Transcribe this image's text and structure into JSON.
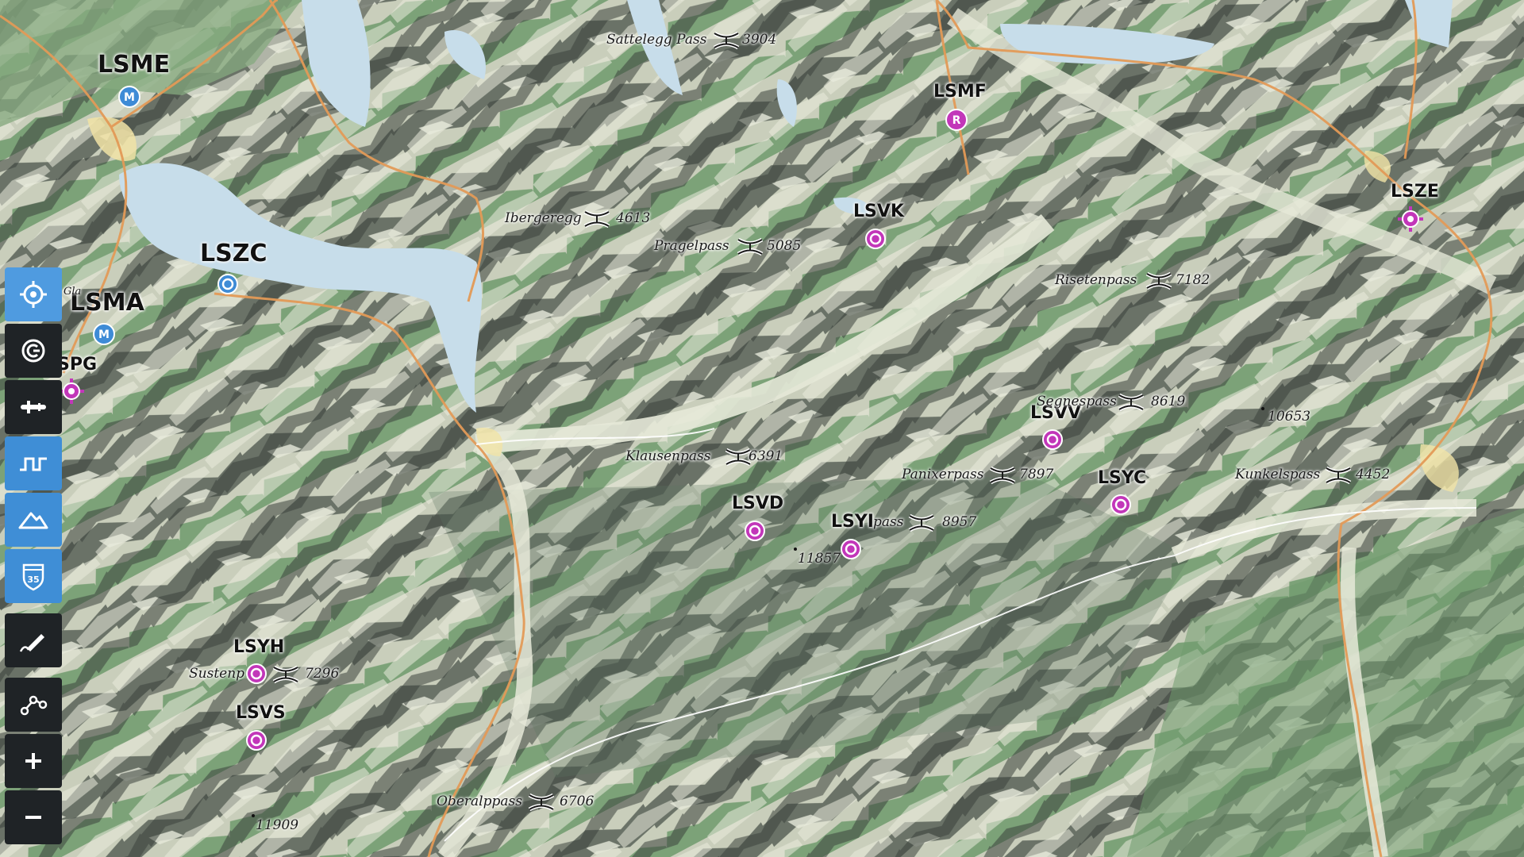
{
  "map": {
    "airfields": [
      {
        "id": "LSME",
        "type": "military"
      },
      {
        "id": "LSZC",
        "type": "civil"
      },
      {
        "id": "LSMA",
        "type": "military"
      },
      {
        "id": "LSPG",
        "type": "heliport"
      },
      {
        "id": "LSMF",
        "type": "military-restricted"
      },
      {
        "id": "LSVK",
        "type": "glider"
      },
      {
        "id": "LSZE",
        "type": "heliport"
      },
      {
        "id": "LSVV",
        "type": "glider"
      },
      {
        "id": "LSYC",
        "type": "glider"
      },
      {
        "id": "LSVD",
        "type": "glider"
      },
      {
        "id": "LSYI",
        "type": "glider"
      },
      {
        "id": "LSYH",
        "type": "glider"
      },
      {
        "id": "LSVS",
        "type": "glider"
      }
    ],
    "airfield_badges": {
      "military": "M",
      "restricted": "R"
    },
    "passes": [
      {
        "name": "Sattelegg Pass",
        "alt": "3904"
      },
      {
        "name": "Ibergeregg",
        "alt": "4613"
      },
      {
        "name": "Pragelpass",
        "alt": "5085"
      },
      {
        "name": "Risetenpass",
        "alt": "7182"
      },
      {
        "name": "Segnespass",
        "alt": "8619"
      },
      {
        "name": "Klausenpass",
        "alt": "6391"
      },
      {
        "name": "Panixerpass",
        "alt": "7897"
      },
      {
        "name": "Kunkelspass",
        "alt": "4452"
      },
      {
        "name": "pass",
        "alt": "8957"
      },
      {
        "name": "Sustenp",
        "alt": "7296"
      },
      {
        "name": "Oberalppass",
        "alt": "6706"
      }
    ],
    "peaks": [
      "10653",
      "11857",
      "11909"
    ],
    "fragment_text": "Gla",
    "colors": {
      "water": "#c7ddea",
      "valley": "#dfe3d1",
      "forest": "#6f9a6d",
      "shadow": "#3e4640",
      "road": "#e39a57",
      "civil_airfield": "#3e8bd6",
      "glider_airfield": "#c236b9"
    }
  },
  "toolbar": {
    "buttons": [
      {
        "icon": "crosshair-locate-icon",
        "style": "blue"
      },
      {
        "icon": "compass-orient-icon",
        "style": "dark"
      },
      {
        "icon": "airplane-profile-icon",
        "style": "dark"
      },
      {
        "icon": "vertical-profile-icon",
        "style": "blue"
      },
      {
        "icon": "terrain-mountain-icon",
        "style": "blue"
      },
      {
        "icon": "airspace-shield-icon",
        "style": "blue",
        "label": "35"
      },
      {
        "icon": "draw-pen-icon",
        "style": "dark"
      },
      {
        "icon": "route-nodes-icon",
        "style": "dark"
      },
      {
        "icon": "zoom-in-icon",
        "style": "dark"
      },
      {
        "icon": "zoom-out-icon",
        "style": "dark"
      }
    ]
  }
}
